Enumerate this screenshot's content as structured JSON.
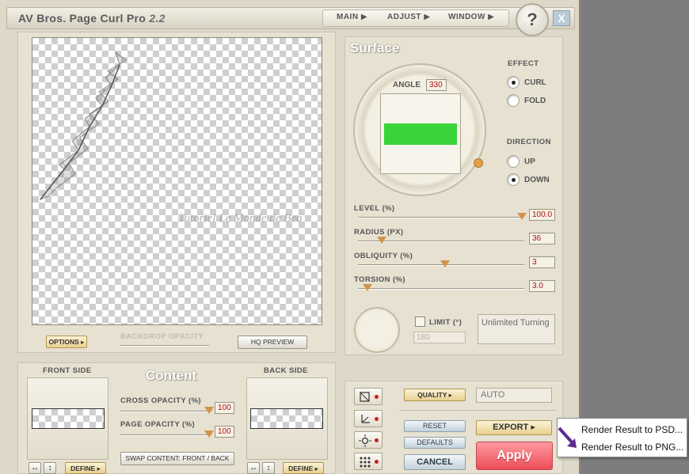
{
  "app": {
    "title": "AV Bros. Page Curl Pro",
    "version": "2.2",
    "menu": [
      "MAIN ▶",
      "ADJUST ▶",
      "WINDOW ▶"
    ],
    "help_label": "?",
    "close_label": "X"
  },
  "preview": {
    "watermark": "Tutoriel Le Monde de Bea",
    "options_label": "OPTIONS ▸",
    "backdrop_label": "BACKDROP OPACITY",
    "hq_label": "HQ PREVIEW"
  },
  "surface": {
    "title": "Surface",
    "angle_label": "ANGLE",
    "angle_value": "330",
    "effect_label": "EFFECT",
    "effect_options": [
      "CURL",
      "FOLD"
    ],
    "effect_selected": "CURL",
    "direction_label": "DIRECTION",
    "direction_options": [
      "UP",
      "DOWN"
    ],
    "direction_selected": "DOWN",
    "sliders": [
      {
        "label": "LEVEL (%)",
        "value": "100.0",
        "fraction": 1.0
      },
      {
        "label": "RADIUS (PX)",
        "value": "36",
        "fraction": 0.1
      },
      {
        "label": "OBLIQUITY (%)",
        "value": "3",
        "fraction": 0.52
      },
      {
        "label": "TORSION (%)",
        "value": "3.0",
        "fraction": 0.05
      }
    ],
    "limit_label": "LIMIT (°)",
    "limit_value": "180",
    "limit_status": "Unlimited Turning",
    "swatch_color": "#3ad43a"
  },
  "content": {
    "title": "Content",
    "front_label": "FRONT SIDE",
    "back_label": "BACK SIDE",
    "cross_label": "CROSS OPACITY (%)",
    "cross_value": "100",
    "page_label": "PAGE OPACITY (%)",
    "page_value": "100",
    "swap_label": "SWAP CONTENT: FRONT / BACK",
    "define_label": "DEFINE ▸"
  },
  "render": {
    "quality_label": "QUALITY ▸",
    "quality_value": "AUTO",
    "reset_label": "RESET",
    "defaults_label": "DEFAULTS",
    "cancel_label": "CANCEL",
    "export_label": "EXPORT ▸",
    "apply_label": "Apply"
  },
  "export_menu": {
    "items": [
      "Render Result to PSD...",
      "Render Result to PNG..."
    ]
  }
}
